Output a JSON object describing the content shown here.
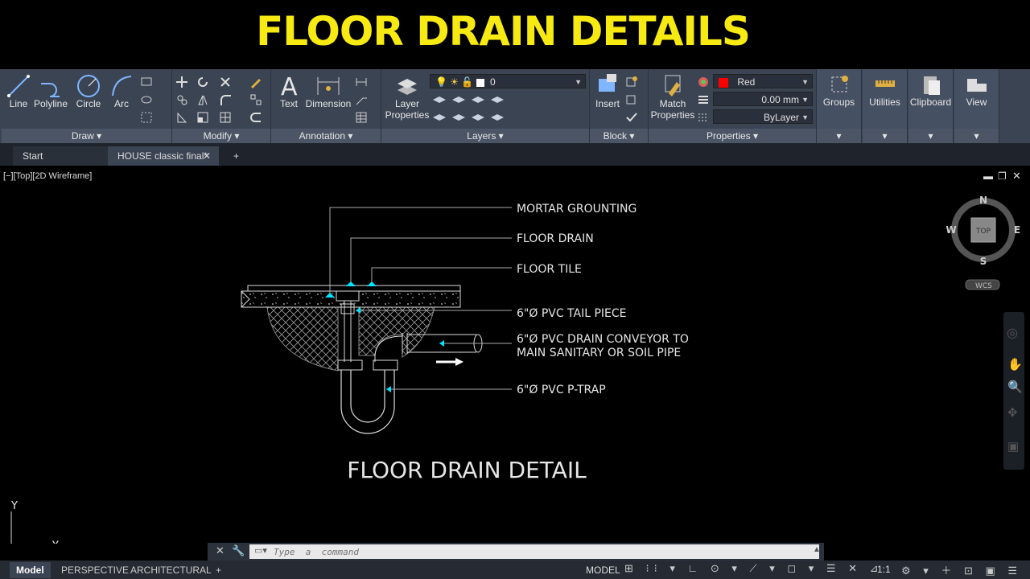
{
  "banner": {
    "title": "FLOOR DRAIN DETAILS",
    "color": "#f7ea12"
  },
  "ribbon": {
    "draw": {
      "title": "Draw",
      "tools": [
        "Line",
        "Polyline",
        "Circle",
        "Arc"
      ]
    },
    "modify": {
      "title": "Modify"
    },
    "annotation": {
      "title": "Annotation",
      "tools": [
        "Text",
        "Dimension"
      ]
    },
    "layers": {
      "title": "Layers",
      "tool_line1": "Layer",
      "tool_line2": "Properties",
      "current_layer": "0"
    },
    "block": {
      "title": "Block",
      "tool": "Insert"
    },
    "properties": {
      "title": "Properties",
      "tool_line1": "Match",
      "tool_line2": "Properties",
      "color": "Red",
      "color_swatch": "#ff0000",
      "lineweight": "0.00 mm",
      "linetype": "ByLayer"
    },
    "extras": [
      {
        "label": "Groups"
      },
      {
        "label": "Utilities"
      },
      {
        "label": "Clipboard"
      },
      {
        "label": "View"
      }
    ]
  },
  "tabs": {
    "start": "Start",
    "document": "HOUSE classic final*"
  },
  "viewport": {
    "label": "[−][Top][2D Wireframe]"
  },
  "viewcube": {
    "n": "N",
    "s": "S",
    "e": "E",
    "w": "W",
    "face": "TOP",
    "ucs": "WCS"
  },
  "drawing": {
    "callouts": [
      "MORTAR GROUNTING",
      "FLOOR DRAIN",
      "FLOOR TILE",
      "6\"Ø PVC TAIL PIECE",
      "6\"Ø PVC DRAIN CONVEYOR TO",
      "MAIN SANITARY OR SOIL PIPE",
      "6\"Ø PVC P-TRAP"
    ],
    "title": "FLOOR DRAIN DETAIL",
    "ucs_x": "X",
    "ucs_y": "Y"
  },
  "command": {
    "placeholder": "Type  a  command"
  },
  "layout_tabs": [
    "Model",
    "PERSPECTIVE",
    "ARCHITECTURAL"
  ],
  "status": {
    "model": "MODEL",
    "scale": "1:1"
  },
  "colors": {
    "ribbon_bg": "#3b4453",
    "accent_cyan": "#00e5ff",
    "canvas": "#000000"
  }
}
